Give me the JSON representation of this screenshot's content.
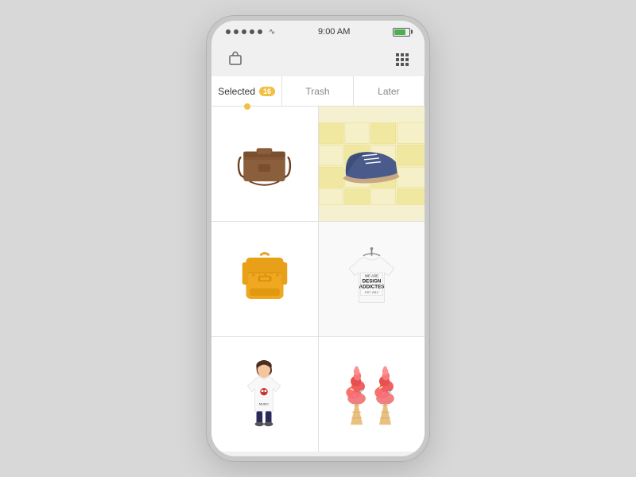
{
  "status_bar": {
    "time": "9:00 AM",
    "signal_dots": 5
  },
  "header": {
    "bag_icon": "bag-icon",
    "grid_icon": "grid-icon"
  },
  "tabs": [
    {
      "id": "selected",
      "label": "Selected",
      "badge": "16",
      "active": true
    },
    {
      "id": "trash",
      "label": "Trash",
      "active": false
    },
    {
      "id": "later",
      "label": "Later",
      "active": false
    }
  ],
  "products": [
    {
      "id": "brown-bag",
      "type": "bag",
      "label": "Brown Messenger Bag"
    },
    {
      "id": "blue-shoe",
      "type": "shoe",
      "label": "Blue Oxford Shoe"
    },
    {
      "id": "yellow-backpack",
      "type": "backpack",
      "label": "Yellow Backpack"
    },
    {
      "id": "design-tshirt",
      "type": "tshirt",
      "label": "Design Addicted T-Shirt"
    },
    {
      "id": "girl-tshirt",
      "type": "girl",
      "label": "Girl T-Shirt"
    },
    {
      "id": "ice-cream",
      "type": "icecream",
      "label": "Ice Cream"
    }
  ]
}
